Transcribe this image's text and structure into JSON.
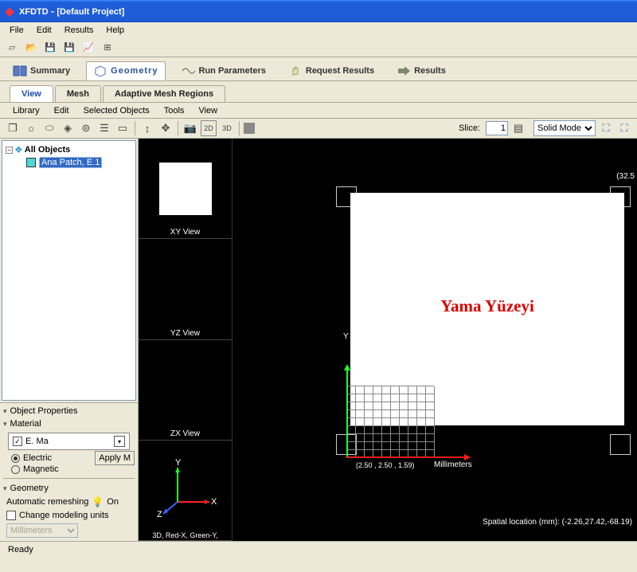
{
  "titlebar": {
    "app_name": "XFDTD",
    "project_name": "[Default Project]"
  },
  "menus": {
    "file": "File",
    "edit": "Edit",
    "results": "Results",
    "help": "Help"
  },
  "nav_tabs": {
    "summary": "Summary",
    "geometry": "Geometry",
    "run_parameters": "Run Parameters",
    "request_results": "Request Results",
    "results": "Results"
  },
  "sub_tabs": {
    "view": "View",
    "mesh": "Mesh",
    "adaptive": "Adaptive Mesh Regions"
  },
  "sub_menus": {
    "library": "Library",
    "edit": "Edit",
    "selected_objects": "Selected Objects",
    "tools": "Tools",
    "view": "View"
  },
  "edit_toolbar": {
    "slice_label": "Slice:",
    "slice_value": "1",
    "mode_options": [
      "Solid Mode"
    ],
    "mode_selected": "Solid Mode"
  },
  "tree": {
    "root": "All Objects",
    "child1": "Ana Patch, E.1"
  },
  "props": {
    "object_properties": "Object Properties",
    "material": "Material",
    "material_value": "E. Ma",
    "radio_electric": "Electric",
    "radio_magnetic": "Magnetic",
    "apply": "Apply M",
    "geometry": "Geometry",
    "remesh_label": "Automatic remeshing",
    "remesh_state": "On",
    "change_units": "Change modeling units",
    "units_selected": "Millimeters"
  },
  "thumb_labels": {
    "xy": "XY View",
    "yz": "YZ View",
    "zx": "ZX View",
    "axes_caption": "3D, Red-X, Green-Y,"
  },
  "viewport": {
    "coord_tr": "(32.5",
    "annotation": "Yama Yüzeyi",
    "axis_y_label": "Y",
    "tick_label": "(2.50 , 2.50 , 1.59)",
    "tick_unit": "Millimeters",
    "status_br": "Spatial location (mm): (-2.26,27.42,-68.19)"
  },
  "statusbar": {
    "ready": "Ready"
  },
  "axes3d_labels": {
    "x": "X",
    "y": "Y",
    "z": "Z"
  }
}
